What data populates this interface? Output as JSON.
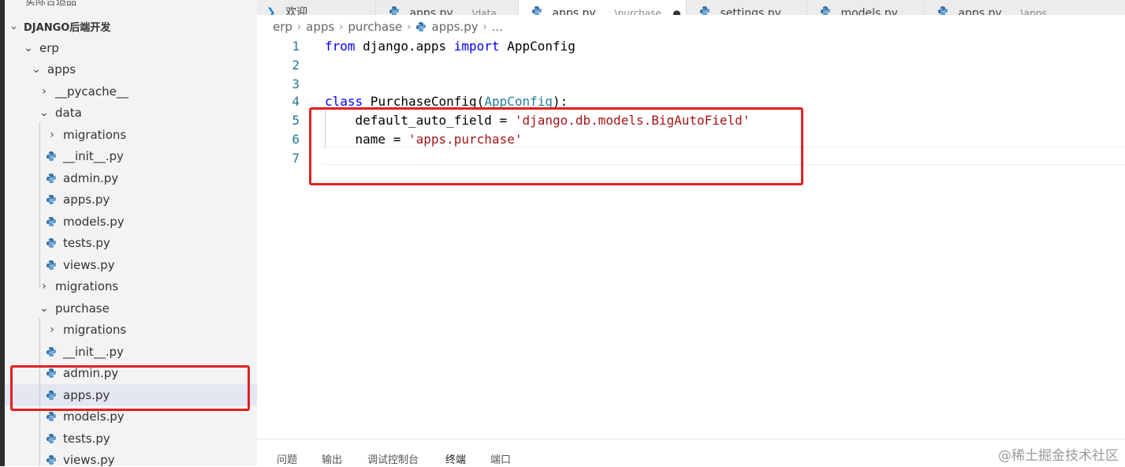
{
  "sidebar": {
    "top_cut_label": "实际合适品",
    "section_title": "DJANGO后端开发",
    "items": [
      {
        "label": "erp",
        "type": "folder-open"
      },
      {
        "label": "apps",
        "type": "folder-open"
      },
      {
        "label": "__pycache__",
        "type": "folder-closed"
      },
      {
        "label": "data",
        "type": "folder-open"
      },
      {
        "label": "migrations",
        "type": "folder-closed"
      },
      {
        "label": "__init__.py",
        "type": "python-file"
      },
      {
        "label": "admin.py",
        "type": "python-file"
      },
      {
        "label": "apps.py",
        "type": "python-file"
      },
      {
        "label": "models.py",
        "type": "python-file"
      },
      {
        "label": "tests.py",
        "type": "python-file"
      },
      {
        "label": "views.py",
        "type": "python-file"
      },
      {
        "label": "migrations",
        "type": "folder-closed"
      },
      {
        "label": "purchase",
        "type": "folder-open"
      },
      {
        "label": "migrations",
        "type": "folder-closed"
      },
      {
        "label": "__init__.py",
        "type": "python-file"
      },
      {
        "label": "admin.py",
        "type": "python-file"
      },
      {
        "label": "apps.py",
        "type": "python-file",
        "selected": true
      },
      {
        "label": "models.py",
        "type": "python-file"
      },
      {
        "label": "tests.py",
        "type": "python-file"
      },
      {
        "label": "views.py",
        "type": "python-file"
      }
    ]
  },
  "tabs": [
    {
      "label": "欢迎",
      "detail": ""
    },
    {
      "label": "apps.py",
      "detail": "...\\data"
    },
    {
      "label": "apps.py",
      "detail": "...\\purchase",
      "active": true,
      "close": "●"
    },
    {
      "label": "settings.py",
      "detail": ""
    },
    {
      "label": "models.py",
      "detail": ""
    },
    {
      "label": "apps.py",
      "detail": "...\\apps"
    }
  ],
  "breadcrumb": [
    "erp",
    "apps",
    "purchase",
    "apps.py",
    "..."
  ],
  "breadcrumb_sep": "›",
  "editor": {
    "line_numbers": [
      "1",
      "2",
      "3",
      "4",
      "5",
      "6",
      "7"
    ],
    "line1": {
      "from": "from",
      "module": " django.apps ",
      "import": "import",
      "name": " AppConfig"
    },
    "line4": {
      "class": "class",
      "name": " PurchaseConfig",
      "open": "(",
      "base": "AppConfig",
      "close": "):"
    },
    "line5": {
      "indent": "    ",
      "field": "default_auto_field = ",
      "value": "'django.db.models.BigAutoField'"
    },
    "line6": {
      "indent": "    ",
      "field": "name = ",
      "value": "'apps.purchase'"
    }
  },
  "panel": {
    "tabs": [
      "问题",
      "输出",
      "调试控制台",
      "终端",
      "端口"
    ],
    "active": "终端"
  },
  "watermark": "@稀土掘金技术社区",
  "colors": {
    "keyword": "#0000ff",
    "class": "#267f99",
    "string": "#a31515",
    "line_number": "#237893",
    "highlight_box": "#e02020",
    "python_icon": "#3572a5"
  }
}
